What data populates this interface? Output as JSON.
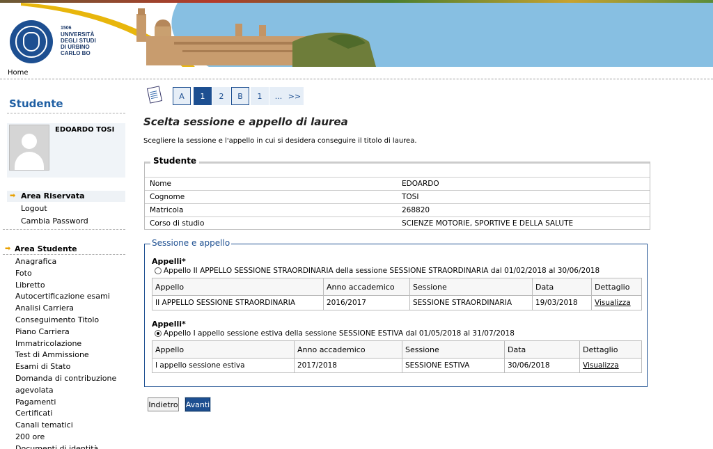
{
  "header": {
    "logo_text": [
      "1506",
      "UNIVERSITÀ",
      "DEGLI STUDI",
      "DI URBINO",
      "CARLO BO"
    ]
  },
  "breadcrumb": {
    "home": "Home"
  },
  "sidebar": {
    "title": "Studente",
    "user_name": "EDOARDO TOSI",
    "reserved": [
      {
        "label": "Area Riservata",
        "active": true
      },
      {
        "label": "Logout"
      },
      {
        "label": "Cambia Password"
      }
    ],
    "section_title": "Area Studente",
    "nav": [
      "Anagrafica",
      "Foto",
      "Libretto",
      "Autocertificazione esami",
      "Analisi Carriera",
      "Conseguimento Titolo",
      "Piano Carriera",
      "Immatricolazione",
      "Test di Ammissione",
      "Esami di Stato",
      "Domanda di contribuzione agevolata",
      "Pagamenti",
      "Certificati",
      "Canali tematici",
      "200 ore",
      "Documenti di identità"
    ]
  },
  "steps": [
    "A",
    "1",
    "2",
    "B",
    "1",
    "...",
    ">>"
  ],
  "page": {
    "title": "Scelta sessione e appello di laurea",
    "description": "Scegliere la sessione e l'appello in cui si desidera conseguire il titolo di laurea."
  },
  "student": {
    "legend": "Studente",
    "rows": [
      {
        "k": "Nome",
        "v": "EDOARDO"
      },
      {
        "k": "Cognome",
        "v": "TOSI"
      },
      {
        "k": "Matricola",
        "v": "268820"
      },
      {
        "k": "Corso di studio",
        "v": "SCIENZE MOTORIE, SPORTIVE E DELLA SALUTE"
      }
    ]
  },
  "sessione": {
    "legend": "Sessione e appello",
    "headers": [
      "Appello",
      "Anno accademico",
      "Sessione",
      "Data",
      "Dettaglio"
    ],
    "groups": [
      {
        "label": "Appelli*",
        "radio": "Appello II APPELLO SESSIONE STRAORDINARIA della sessione SESSIONE STRAORDINARIA dal 01/02/2018 al 30/06/2018",
        "checked": false,
        "row": [
          "II APPELLO SESSIONE STRAORDINARIA",
          "2016/2017",
          "SESSIONE STRAORDINARIA",
          "19/03/2018",
          "Visualizza"
        ]
      },
      {
        "label": "Appelli*",
        "radio": "Appello I appello sessione estiva della sessione SESSIONE ESTIVA dal 01/05/2018 al 31/07/2018",
        "checked": true,
        "row": [
          "I appello sessione estiva",
          "2017/2018",
          "SESSIONE ESTIVA",
          "30/06/2018",
          "Visualizza"
        ]
      }
    ]
  },
  "buttons": {
    "back": "Indietro",
    "next": "Avanti"
  }
}
